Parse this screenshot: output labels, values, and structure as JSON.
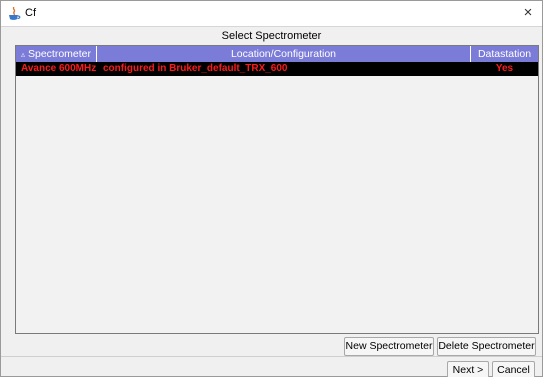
{
  "window": {
    "title": "Cf",
    "app_icon": "java-cup-icon",
    "close_label": "×"
  },
  "header": {
    "title": "Select Spectrometer"
  },
  "table": {
    "columns": [
      {
        "label": "Spectrometer",
        "sort_indicator": "▵"
      },
      {
        "label": "Location/Configuration"
      },
      {
        "label": "Datastation"
      }
    ],
    "rows": [
      {
        "spectrometer": "Avance 600MHz",
        "location": "configured in Bruker_default_TRX_600",
        "datastation": "Yes"
      }
    ]
  },
  "buttons": {
    "new_spectrometer": "New Spectrometer",
    "delete_spectrometer": "Delete Spectrometer",
    "next": "Next >",
    "cancel": "Cancel"
  },
  "colors": {
    "header_bg": "#7b7bd8",
    "row_bg": "#000000",
    "row_text": "#ff1a1a"
  }
}
